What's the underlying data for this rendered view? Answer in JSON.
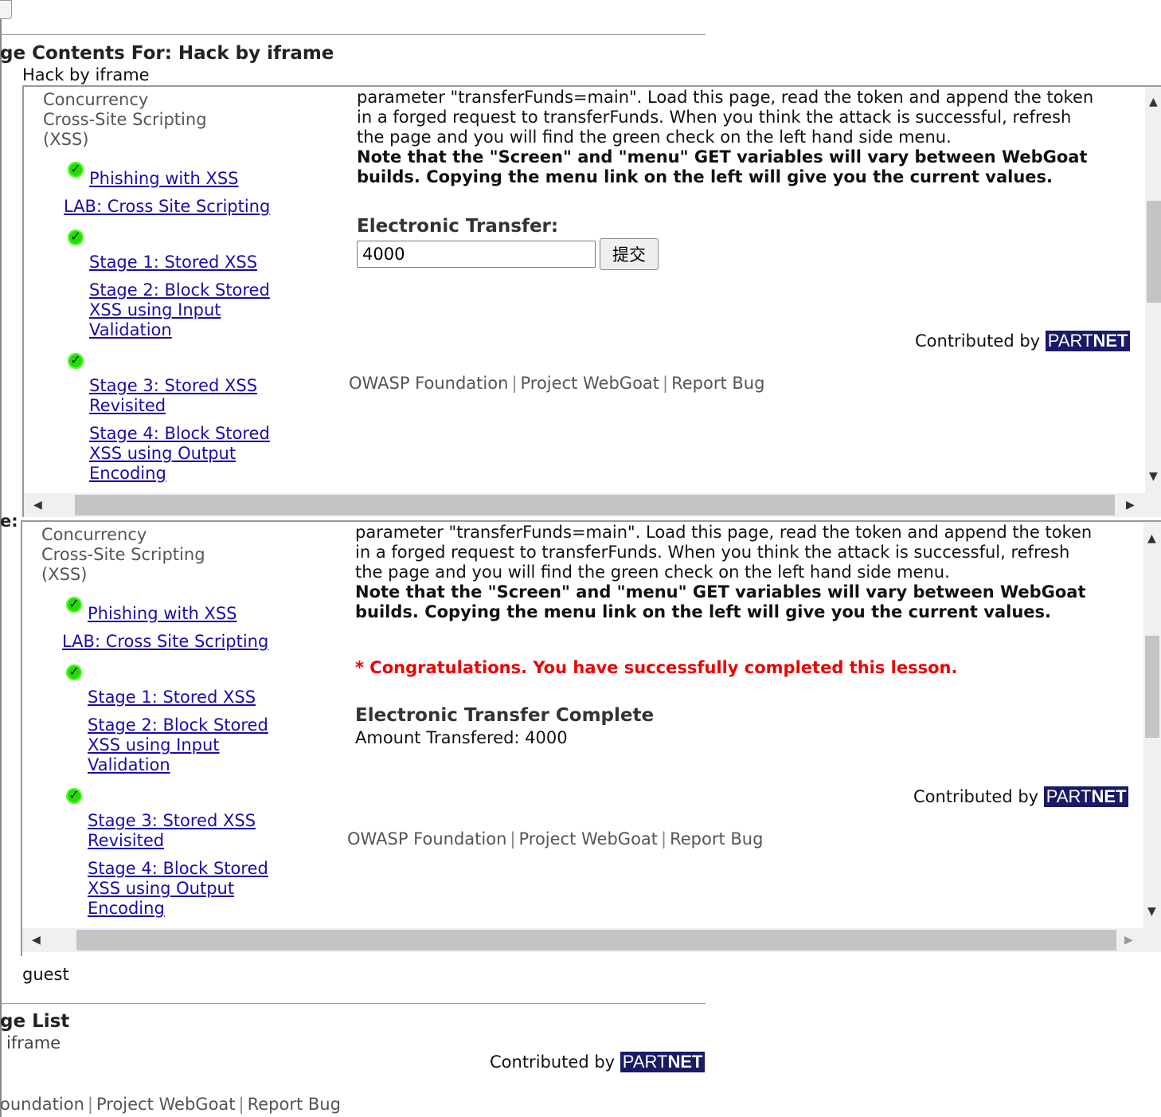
{
  "page": {
    "section_title": "ge Contents For: Hack by iframe",
    "section_subtitle": "Hack by iframe",
    "side_label": "e:",
    "user": "guest",
    "list_title": "ge List",
    "list_item": "iframe",
    "contributed_by": "Contributed by",
    "partnet_part": "PART",
    "partnet_net": "NET",
    "footer": {
      "owasp": "oundation",
      "webgoat": "Project WebGoat",
      "bug": "Report Bug",
      "sep": "|"
    }
  },
  "nav": {
    "concurrency": "Concurrency",
    "xss_line1": "Cross-Site Scripting",
    "xss_line2": "(XSS)",
    "phishing": "Phishing with XSS",
    "lab": "LAB: Cross Site Scripting",
    "stage1": "Stage 1: Stored XSS",
    "stage2_l1": "Stage 2: Block Stored",
    "stage2_l2": "XSS using Input",
    "stage2_l3": "Validation",
    "stage3_l1": "Stage 3: Stored XSS",
    "stage3_l2": "Revisited",
    "stage4_l1": "Stage 4: Block Stored",
    "stage4_l2": "XSS using Output",
    "stage4_l3": "Encoding",
    "check": "✓"
  },
  "lesson": {
    "line1": "parameter \"transferFunds=main\". Load this page, read the token and append the token",
    "line2": "in a forged request to transferFunds. When you think the attack is successful, refresh",
    "line3": "the page and you will find the green check on the left hand side menu.",
    "note1": "Note that the \"Screen\" and \"menu\" GET variables will vary between WebGoat",
    "note2": "builds. Copying the menu link on the left will give you the current values."
  },
  "frame1": {
    "transfer_title": "Electronic Transfer:",
    "amount_value": "4000",
    "submit_label": "提交",
    "footer_owasp": "OWASP Foundation",
    "footer_webgoat": "Project WebGoat",
    "footer_bug": "Report Bug"
  },
  "frame2": {
    "congrats": "* Congratulations. You have successfully completed this lesson.",
    "complete_title": "Electronic Transfer Complete",
    "amount_text": "Amount Transfered: 4000",
    "footer_owasp": "OWASP Foundation",
    "footer_webgoat": "Project WebGoat",
    "footer_bug": "Report Bug"
  },
  "colors": {
    "link": "#1a0dab",
    "congrats": "#e00000",
    "partnet_bg": "#1a1a66",
    "check": "#22dd00"
  }
}
